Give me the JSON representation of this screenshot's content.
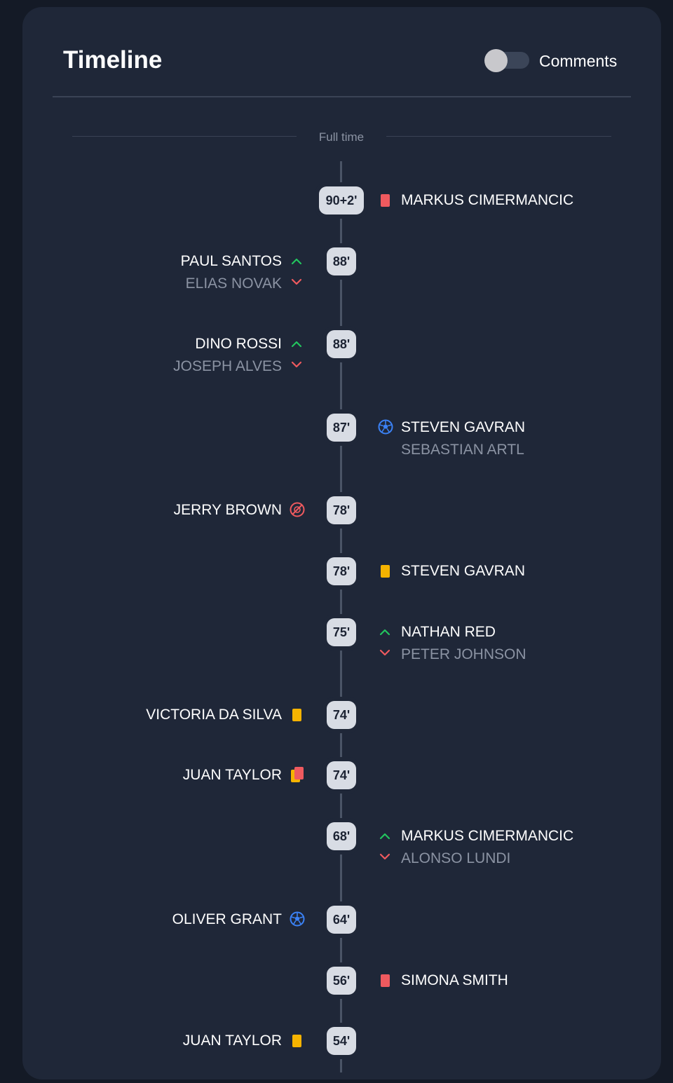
{
  "header": {
    "title": "Timeline",
    "comments_toggle": {
      "label": "Comments",
      "on": false
    }
  },
  "full_time_label": "Full time",
  "colors": {
    "background": "#141a26",
    "card": "#1f2738",
    "accent_up": "#22c55e",
    "accent_down": "#ef5a5f",
    "red_card": "#ef5a5f",
    "yellow_card": "#f5b300",
    "goal": "#3b82f6"
  },
  "events": [
    {
      "minute": "90+2'",
      "side": "right",
      "icon": "red-card-icon",
      "player": "MARKUS CIMERMANCIC"
    },
    {
      "minute": "88'",
      "side": "left",
      "icon": "substitution-icon",
      "player": "PAUL SANTOS",
      "secondary": "ELIAS NOVAK"
    },
    {
      "minute": "88'",
      "side": "left",
      "icon": "substitution-icon",
      "player": "DINO ROSSI",
      "secondary": "JOSEPH ALVES"
    },
    {
      "minute": "87'",
      "side": "right",
      "icon": "goal-icon",
      "player": "STEVEN GAVRAN",
      "secondary": "SEBASTIAN ARTL"
    },
    {
      "minute": "78'",
      "side": "left",
      "icon": "missed-penalty-icon",
      "player": "JERRY BROWN"
    },
    {
      "minute": "78'",
      "side": "right",
      "icon": "yellow-card-icon",
      "player": "STEVEN GAVRAN"
    },
    {
      "minute": "75'",
      "side": "right",
      "icon": "substitution-icon",
      "player": "NATHAN RED",
      "secondary": "PETER JOHNSON"
    },
    {
      "minute": "74'",
      "side": "left",
      "icon": "yellow-card-icon",
      "player": "VICTORIA DA SILVA"
    },
    {
      "minute": "74'",
      "side": "left",
      "icon": "second-yellow-card-icon",
      "player": "JUAN TAYLOR"
    },
    {
      "minute": "68'",
      "side": "right",
      "icon": "substitution-icon",
      "player": "MARKUS CIMERMANCIC",
      "secondary": "ALONSO LUNDI"
    },
    {
      "minute": "64'",
      "side": "left",
      "icon": "goal-icon",
      "player": "OLIVER GRANT"
    },
    {
      "minute": "56'",
      "side": "right",
      "icon": "red-card-icon",
      "player": "SIMONA SMITH"
    },
    {
      "minute": "54'",
      "side": "left",
      "icon": "yellow-card-icon",
      "player": "JUAN TAYLOR"
    }
  ]
}
